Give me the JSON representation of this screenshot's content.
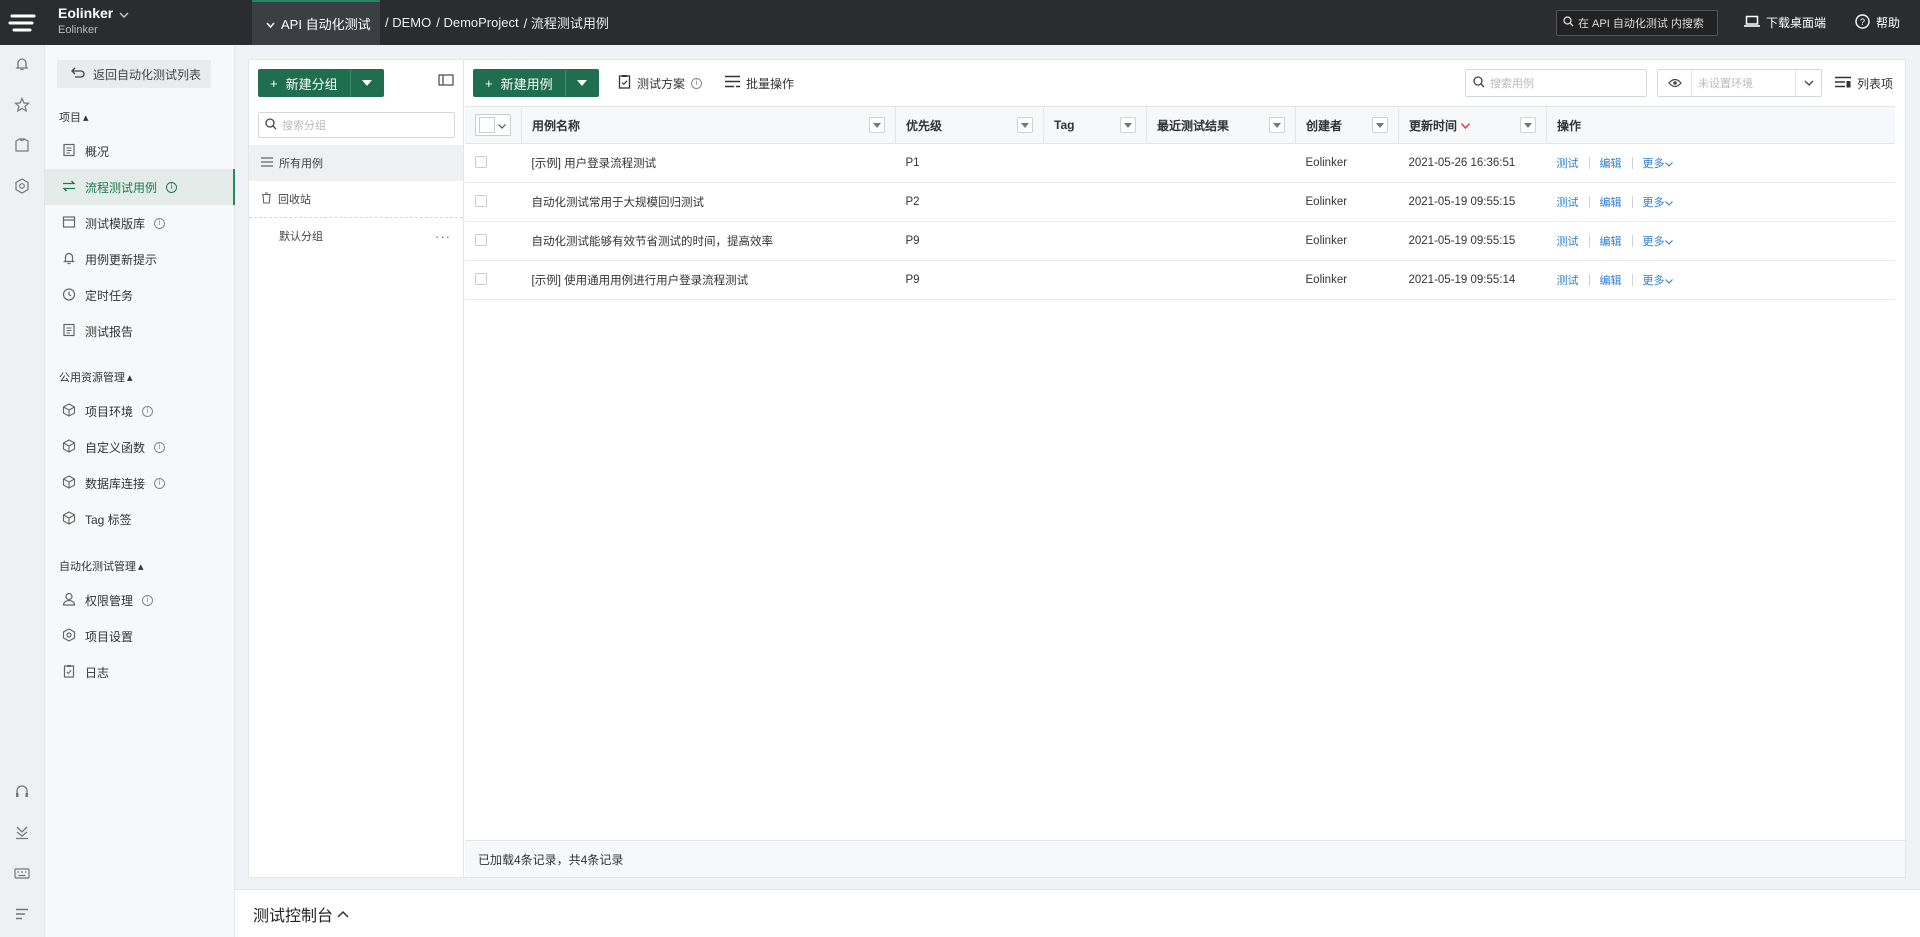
{
  "topbar": {
    "workspace_name": "Eolinker",
    "workspace_sub": "Eolinker",
    "module": "API 自动化测试",
    "breadcrumbs": [
      "/ DEMO",
      "/ DemoProject",
      "/ 流程测试用例"
    ],
    "search_placeholder": "在 API 自动化测试 内搜索",
    "download": "下载桌面端",
    "help": "帮助"
  },
  "sidebar": {
    "back": "返回自动化测试列表",
    "section_project": "项目",
    "section_public": "公用资源管理",
    "section_admin": "自动化测试管理",
    "items": [
      {
        "label": "概况"
      },
      {
        "label": "流程测试用例"
      },
      {
        "label": "测试模版库"
      },
      {
        "label": "用例更新提示"
      },
      {
        "label": "定时任务"
      },
      {
        "label": "测试报告"
      },
      {
        "label": "项目环境"
      },
      {
        "label": "自定义函数"
      },
      {
        "label": "数据库连接"
      },
      {
        "label": "Tag 标签"
      },
      {
        "label": "权限管理"
      },
      {
        "label": "项目设置"
      },
      {
        "label": "日志"
      }
    ]
  },
  "groups": {
    "new_group": "新建分组",
    "search_placeholder": "搜索分组",
    "all": "所有用例",
    "recycle": "回收站",
    "default": "默认分组"
  },
  "toolbar": {
    "new_case": "新建用例",
    "test_plan": "测试方案",
    "batch": "批量操作",
    "search_placeholder": "搜索用例",
    "env_placeholder": "未设置环境",
    "columns": "列表项"
  },
  "table": {
    "headers": [
      "用例名称",
      "优先级",
      "Tag",
      "最近测试结果",
      "创建者",
      "更新时间",
      "操作"
    ],
    "rows": [
      {
        "name": "[示例] 用户登录流程测试",
        "priority": "P1",
        "tag": "",
        "result": "",
        "creator": "Eolinker",
        "time": "2021-05-26 16:36:51"
      },
      {
        "name": "自动化测试常用于大规模回归测试",
        "priority": "P2",
        "tag": "",
        "result": "",
        "creator": "Eolinker",
        "time": "2021-05-19 09:55:15"
      },
      {
        "name": "自动化测试能够有效节省测试的时间，提高效率",
        "priority": "P9",
        "tag": "",
        "result": "",
        "creator": "Eolinker",
        "time": "2021-05-19 09:55:15"
      },
      {
        "name": "[示例] 使用通用用例进行用户登录流程测试",
        "priority": "P9",
        "tag": "",
        "result": "",
        "creator": "Eolinker",
        "time": "2021-05-19 09:55:14"
      }
    ],
    "op_test": "测试",
    "op_edit": "编辑",
    "op_more": "更多"
  },
  "footer": "已加载4条记录，共4条记录",
  "console": "测试控制台",
  "colors": {
    "brand_green": "#1e6e4f",
    "link_blue": "#2e7ed1",
    "sort_red": "#e04040"
  }
}
